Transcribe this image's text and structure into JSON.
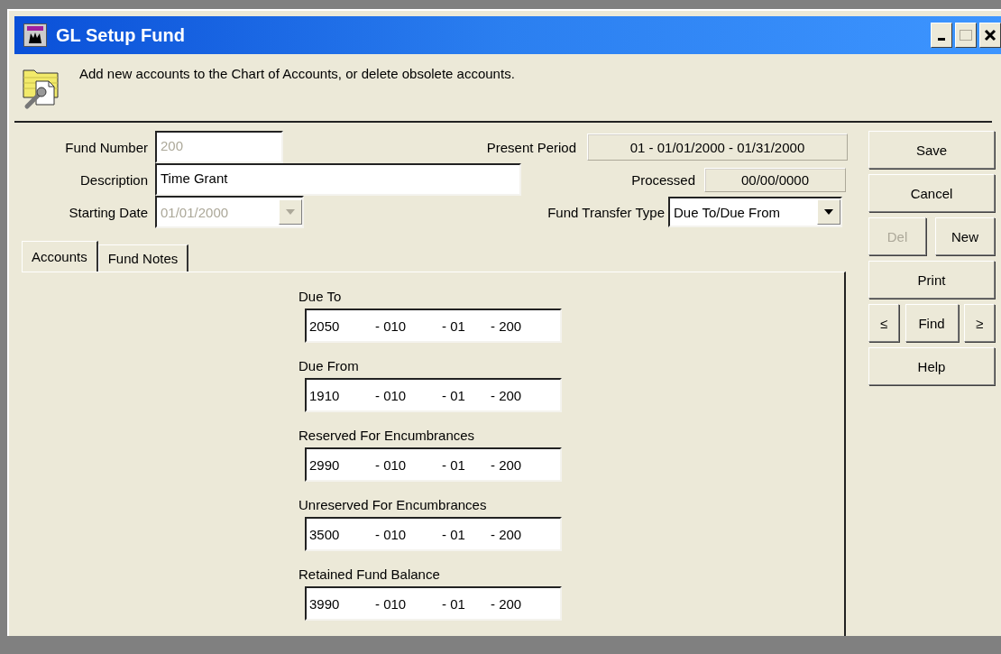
{
  "window": {
    "title": "GL Setup Fund",
    "controls": [
      {
        "kind": "minimize",
        "disabled": false
      },
      {
        "kind": "maximize",
        "disabled": true
      },
      {
        "kind": "close",
        "disabled": false
      }
    ]
  },
  "header": {
    "text": "Add new accounts to the Chart of Accounts, or delete obsolete accounts."
  },
  "fields": [
    {
      "label": "Fund Number",
      "value": "200",
      "disabled": true,
      "kind": "text"
    },
    {
      "label": "Description",
      "value": "Time Grant",
      "disabled": false,
      "kind": "text"
    },
    {
      "label": "Starting Date",
      "value": "01/01/2000",
      "disabled": true,
      "kind": "combo"
    }
  ],
  "info": [
    {
      "label": "Present Period",
      "value": "01 - 01/01/2000 - 01/31/2000",
      "kind": "readout"
    },
    {
      "label": "Processed",
      "value": "00/00/0000",
      "kind": "readout"
    },
    {
      "label": "Fund Transfer Type",
      "value": "Due To/Due From",
      "kind": "select"
    }
  ],
  "tabs": [
    {
      "label": "Accounts",
      "selected": true
    },
    {
      "label": "Fund Notes",
      "selected": false
    }
  ],
  "accounts": [
    {
      "label": "Due To",
      "segments": [
        "2050",
        "- 010",
        "- 01",
        "- 200"
      ]
    },
    {
      "label": "Due From",
      "segments": [
        "1910",
        "- 010",
        "- 01",
        "- 200"
      ]
    },
    {
      "label": "Reserved For Encumbrances",
      "segments": [
        "2990",
        "- 010",
        "- 01",
        "- 200"
      ]
    },
    {
      "label": "Unreserved For Encumbrances",
      "segments": [
        "3500",
        "- 010",
        "- 01",
        "- 200"
      ]
    },
    {
      "label": "Retained Fund Balance",
      "segments": [
        "3990",
        "- 010",
        "- 01",
        "- 200"
      ]
    }
  ],
  "buttons": [
    [
      {
        "label": "Save",
        "disabled": false
      }
    ],
    [
      {
        "label": "Cancel",
        "disabled": false
      }
    ],
    [
      {
        "label": "Del",
        "disabled": true
      },
      {
        "label": "New",
        "disabled": false
      }
    ],
    [
      {
        "label": "Print",
        "disabled": false
      }
    ],
    [
      {
        "label": "≤",
        "disabled": false
      },
      {
        "label": "Find",
        "disabled": false
      },
      {
        "label": "≥",
        "disabled": false
      }
    ],
    [
      {
        "label": "Help",
        "disabled": false
      }
    ]
  ]
}
